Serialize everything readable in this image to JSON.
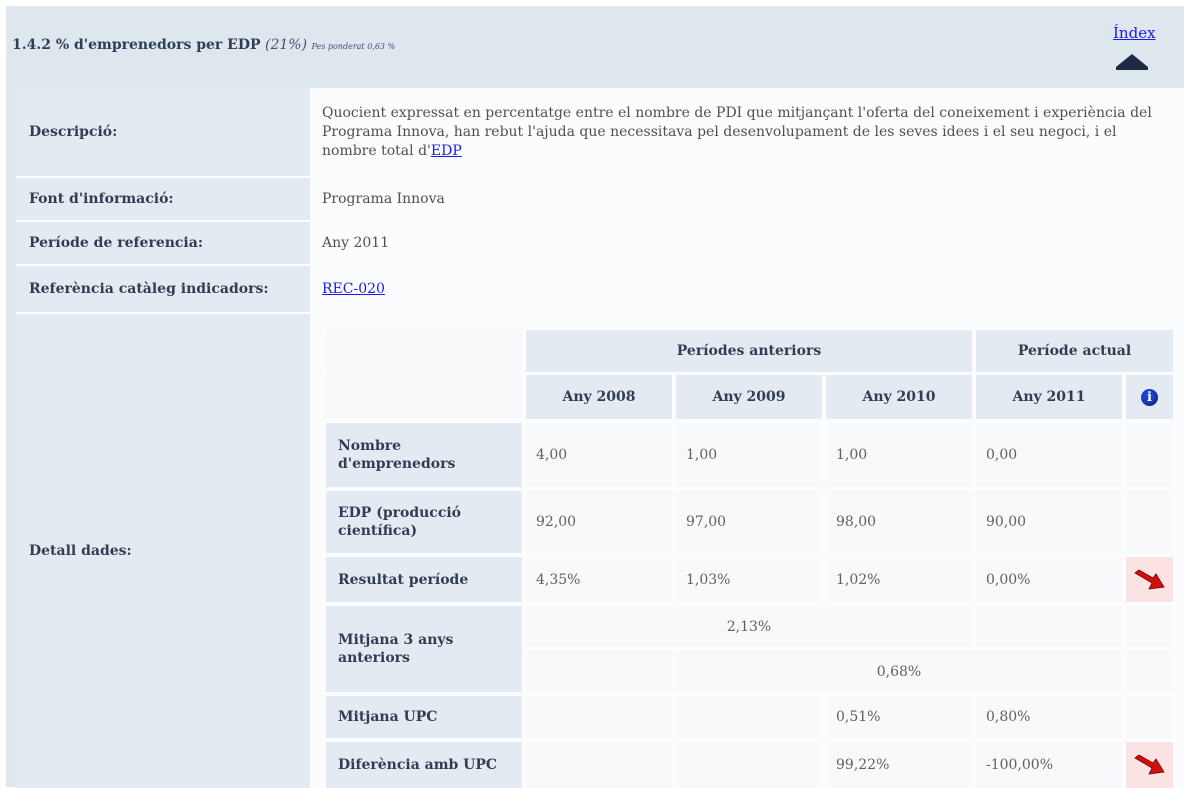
{
  "header": {
    "code_title": "1.4.2 % d'emprenedors per EDP",
    "percentage": "(21%)",
    "weight": "Pes ponderat 0,63 %",
    "index_link": "Índex"
  },
  "rows": {
    "description": {
      "label": "Descripció:",
      "text": "Quocient expressat en percentatge entre el nombre de PDI que mitjançant l'oferta del coneixement i experiència del Programa Innova, han rebut l'ajuda que necessitava pel desenvolupament de les seves idees i el seu negoci, i el nombre total d'",
      "link": "EDP"
    },
    "source": {
      "label": "Font d'informació:",
      "value": "Programa Innova"
    },
    "period": {
      "label": "Període de referencia:",
      "value": "Any 2011"
    },
    "catalog": {
      "label": "Referència catàleg indicadors:",
      "link": "REC-020"
    },
    "detail": {
      "label": "Detall dades:"
    }
  },
  "table": {
    "group_prev": "Períodes anteriors",
    "group_curr": "Període actual",
    "years": [
      "Any 2008",
      "Any 2009",
      "Any 2010",
      "Any 2011"
    ],
    "rows": [
      {
        "label": "Nombre d'emprenedors",
        "values": [
          "4,00",
          "1,00",
          "1,00",
          "0,00"
        ]
      },
      {
        "label": "EDP (producció científica)",
        "values": [
          "92,00",
          "97,00",
          "98,00",
          "90,00"
        ]
      },
      {
        "label": "Resultat període",
        "values": [
          "4,35%",
          "1,03%",
          "1,02%",
          "0,00%"
        ],
        "trend": "down"
      },
      {
        "label": "Mitjana 3 anys anteriors",
        "avg_prev": "2,13%",
        "avg_curr": "0,68%"
      },
      {
        "label": "Mitjana UPC",
        "values": [
          "",
          "",
          "0,51%",
          "0,80%"
        ]
      },
      {
        "label": "Diferència amb UPC",
        "values": [
          "",
          "",
          "99,22%",
          "-100,00%"
        ],
        "trend": "down"
      }
    ]
  },
  "icons": {
    "info": "info-icon",
    "trend": "down-arrow-icon",
    "index": "up-triangle-icon"
  },
  "colors": {
    "link": "#1a1aee",
    "trend_arrow": "#d01010",
    "trend_bg": "#fbe3e3",
    "info": "#1b3fd0"
  }
}
